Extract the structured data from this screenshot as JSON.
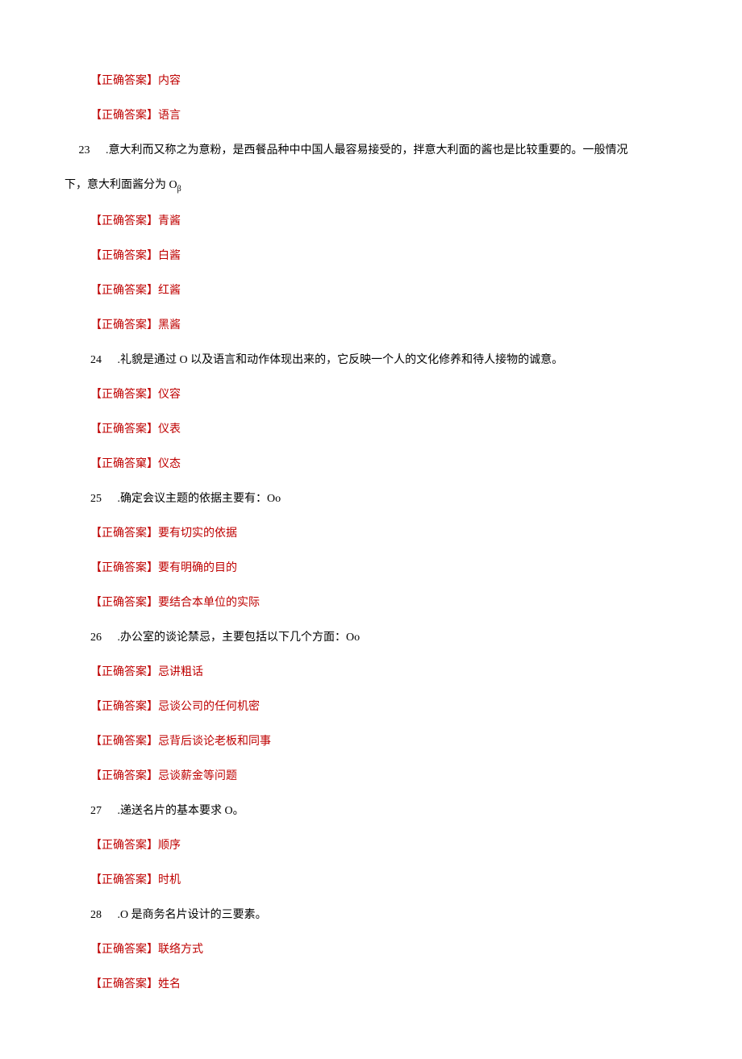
{
  "labels": {
    "correct_answer": "【正确答案】"
  },
  "pre_answers": [
    "内容",
    "语言"
  ],
  "questions": [
    {
      "num": "23",
      "text": " .意大利而又称之为意粉，是西餐品种中中国人最容易接受的，拌意大利面的酱也是比较重要的。一般情况",
      "continuation": "下，意大利面酱分为 O",
      "cont_sub": "β",
      "wide": true,
      "answers": [
        "青酱",
        "白酱",
        "红酱",
        "黑酱"
      ]
    },
    {
      "num": "24",
      "text": " .礼貌是通过 O 以及语言和动作体现出来的，它反映一个人的文化修养和待人接物的诚意。",
      "answers_special": [
        {
          "label": "【正确答案】",
          "text": "仪容"
        },
        {
          "label": "【正确答案】",
          "text": "仪表"
        },
        {
          "label": "【正确答窠】",
          "text": "仪态"
        }
      ]
    },
    {
      "num": "25",
      "text": "   .确定会议主题的依据主要有：Oo",
      "answers": [
        "要有切实的依据",
        "要有明确的目的",
        "要结合本单位的实际"
      ]
    },
    {
      "num": "26",
      "text": "   .办公室的谈论禁忌，主要包括以下几个方面：Oo",
      "answers": [
        "忌讲粗话",
        "忌谈公司的任何机密",
        "忌背后谈论老板和同事",
        "忌谈薪金等问题"
      ]
    },
    {
      "num": "27",
      "text": "   .递送名片的基本要求 O。",
      "answers": [
        "顺序",
        "时机"
      ]
    },
    {
      "num": "28",
      "text": "   .O 是商务名片设计的三要素。",
      "answers": [
        "联络方式",
        "姓名"
      ]
    }
  ]
}
